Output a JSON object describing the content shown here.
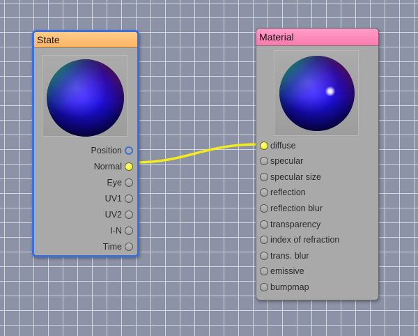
{
  "nodes": {
    "state": {
      "title": "State",
      "outputs": [
        "Position",
        "Normal",
        "Eye",
        "UV1",
        "UV2",
        "I-N",
        "Time"
      ]
    },
    "material": {
      "title": "Material",
      "inputs": [
        "diffuse",
        "specular",
        "specular size",
        "reflection",
        "reflection blur",
        "transparency",
        "index of refraction",
        "trans. blur",
        "emissive",
        "bumpmap"
      ]
    }
  },
  "connection": {
    "from": "State.Normal",
    "to": "Material.diffuse",
    "color": "#f5ec1a"
  },
  "colors": {
    "canvas": "#8c93a6",
    "grid": "#e6e9f0",
    "state_header": "#ffbf78",
    "material_header": "#fb86bb",
    "selection_border": "#3f6fd8",
    "node_body": "#a9a9a9"
  },
  "icons": [
    "sphere-preview",
    "port-dot"
  ]
}
